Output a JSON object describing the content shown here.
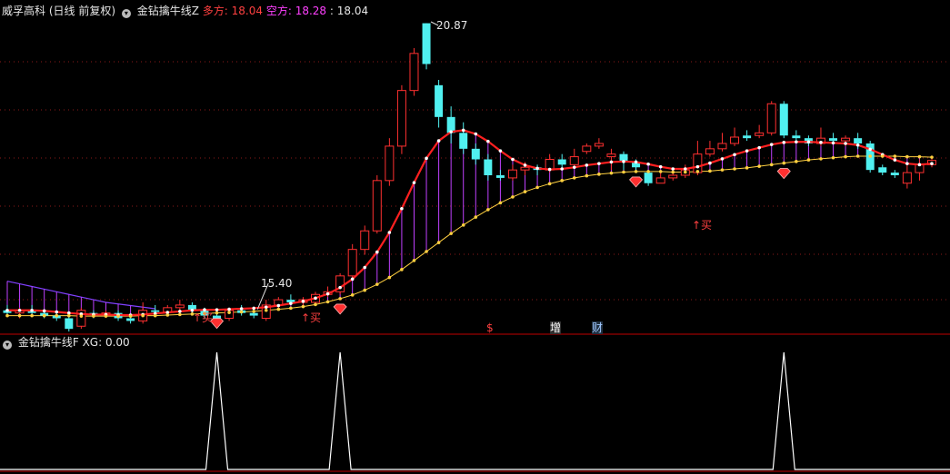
{
  "main_header": {
    "stock": "威孚高科",
    "period": "(日线 前复权)",
    "indicator": "金钻擒牛线Z",
    "bull_label": "多方:",
    "bull_value": "18.04",
    "bear_label": "空方:",
    "bear_value": "18.28",
    "close_value": ": 18.04"
  },
  "sub_header": {
    "indicator": "金钻擒牛线F",
    "xg_label": "XG:",
    "xg_value": "0.00"
  },
  "colors": {
    "up": "#ff3030",
    "down": "#50f0f0",
    "bull_line": "#ff2020",
    "bear_line": "#8040ff",
    "fill": "#c040ff",
    "signal": "#ff3030",
    "grid": "#8b1a1a",
    "xg_line": "#ffffff"
  },
  "annotations": {
    "high": "20.87",
    "low": "15.40",
    "buy": "↑买",
    "mark_dollar": "$",
    "mark_zeng": "增",
    "mark_cai": "财"
  },
  "chart_data": {
    "type": "candlestick",
    "candles": [
      [
        15.45,
        15.4,
        15.55,
        15.35
      ],
      [
        15.4,
        15.45,
        15.5,
        15.3
      ],
      [
        15.45,
        15.4,
        15.55,
        15.35
      ],
      [
        15.4,
        15.35,
        15.45,
        15.3
      ],
      [
        15.35,
        15.3,
        15.4,
        15.25
      ],
      [
        15.3,
        15.1,
        15.35,
        15.05
      ],
      [
        15.15,
        15.45,
        15.5,
        15.1
      ],
      [
        15.4,
        15.38,
        15.45,
        15.3
      ],
      [
        15.38,
        15.4,
        15.45,
        15.32
      ],
      [
        15.4,
        15.3,
        15.45,
        15.25
      ],
      [
        15.3,
        15.25,
        15.38,
        15.2
      ],
      [
        15.25,
        15.45,
        15.6,
        15.2
      ],
      [
        15.45,
        15.42,
        15.55,
        15.38
      ],
      [
        15.42,
        15.5,
        15.55,
        15.4
      ],
      [
        15.5,
        15.55,
        15.65,
        15.45
      ],
      [
        15.55,
        15.45,
        15.6,
        15.4
      ],
      [
        15.45,
        15.35,
        15.5,
        15.3
      ],
      [
        15.35,
        15.3,
        15.4,
        15.28
      ],
      [
        15.3,
        15.45,
        15.5,
        15.25
      ],
      [
        15.45,
        15.4,
        15.55,
        15.35
      ],
      [
        15.4,
        15.35,
        15.5,
        15.3
      ],
      [
        15.3,
        15.55,
        15.65,
        15.25
      ],
      [
        15.55,
        15.65,
        15.7,
        15.5
      ],
      [
        15.65,
        15.6,
        15.75,
        15.55
      ],
      [
        15.6,
        15.65,
        15.7,
        15.55
      ],
      [
        15.6,
        15.75,
        15.8,
        15.55
      ],
      [
        15.75,
        15.8,
        15.9,
        15.7
      ],
      [
        15.8,
        16.1,
        16.15,
        15.75
      ],
      [
        16.1,
        16.6,
        16.7,
        16.05
      ],
      [
        16.6,
        16.95,
        17.05,
        16.5
      ],
      [
        16.95,
        17.9,
        18.0,
        16.9
      ],
      [
        17.9,
        18.55,
        18.7,
        17.8
      ],
      [
        18.55,
        19.6,
        19.7,
        18.4
      ],
      [
        19.6,
        20.3,
        20.4,
        19.5
      ],
      [
        20.87,
        20.1,
        20.87,
        20.0
      ],
      [
        19.7,
        19.1,
        19.8,
        18.9
      ],
      [
        19.1,
        18.8,
        19.3,
        18.6
      ],
      [
        18.8,
        18.5,
        19.0,
        18.4
      ],
      [
        18.5,
        18.3,
        18.6,
        18.2
      ],
      [
        18.3,
        18.0,
        18.4,
        17.9
      ],
      [
        18.0,
        17.95,
        18.1,
        17.9
      ],
      [
        17.95,
        18.1,
        18.2,
        17.9
      ],
      [
        18.1,
        18.15,
        18.25,
        18.0
      ],
      [
        18.15,
        18.1,
        18.2,
        18.0
      ],
      [
        18.1,
        18.3,
        18.4,
        18.05
      ],
      [
        18.3,
        18.2,
        18.4,
        18.1
      ],
      [
        18.2,
        18.35,
        18.5,
        18.15
      ],
      [
        18.45,
        18.55,
        18.6,
        18.4
      ],
      [
        18.55,
        18.6,
        18.7,
        18.5
      ],
      [
        18.35,
        18.4,
        18.5,
        18.1
      ],
      [
        18.4,
        18.25,
        18.45,
        18.1
      ],
      [
        18.25,
        18.15,
        18.3,
        18.05
      ],
      [
        18.05,
        17.85,
        18.1,
        17.8
      ],
      [
        17.85,
        17.95,
        18.05,
        17.85
      ],
      [
        17.95,
        18.0,
        18.1,
        17.9
      ],
      [
        18.0,
        18.1,
        18.2,
        17.95
      ],
      [
        18.05,
        18.4,
        18.65,
        18.0
      ],
      [
        18.4,
        18.5,
        18.65,
        18.35
      ],
      [
        18.5,
        18.6,
        18.8,
        18.45
      ],
      [
        18.6,
        18.72,
        18.9,
        18.55
      ],
      [
        18.75,
        18.7,
        18.85,
        18.65
      ],
      [
        18.75,
        18.8,
        18.95,
        18.7
      ],
      [
        18.8,
        19.35,
        19.4,
        18.75
      ],
      [
        19.35,
        18.75,
        19.4,
        18.7
      ],
      [
        18.75,
        18.7,
        18.85,
        18.6
      ],
      [
        18.7,
        18.6,
        18.75,
        18.55
      ],
      [
        18.6,
        18.7,
        18.9,
        18.55
      ],
      [
        18.7,
        18.65,
        18.8,
        18.6
      ],
      [
        18.65,
        18.7,
        18.75,
        18.55
      ],
      [
        18.7,
        18.6,
        18.8,
        18.5
      ],
      [
        18.6,
        18.1,
        18.65,
        18.05
      ],
      [
        18.15,
        18.05,
        18.2,
        18.0
      ],
      [
        18.05,
        18.0,
        18.1,
        17.95
      ],
      [
        17.85,
        18.05,
        18.2,
        17.75
      ],
      [
        18.05,
        18.2,
        18.3,
        17.9
      ],
      [
        18.2,
        18.28,
        18.35,
        18.15
      ]
    ],
    "bull": [
      15.45,
      15.45,
      15.45,
      15.44,
      15.42,
      15.4,
      15.38,
      15.37,
      15.37,
      15.36,
      15.36,
      15.37,
      15.39,
      15.41,
      15.43,
      15.45,
      15.46,
      15.46,
      15.47,
      15.48,
      15.49,
      15.51,
      15.54,
      15.58,
      15.62,
      15.68,
      15.76,
      15.88,
      16.04,
      16.26,
      16.55,
      16.92,
      17.37,
      17.86,
      18.32,
      18.65,
      18.82,
      18.85,
      18.78,
      18.64,
      18.46,
      18.3,
      18.19,
      18.13,
      18.11,
      18.12,
      18.15,
      18.19,
      18.22,
      18.25,
      18.26,
      18.25,
      18.21,
      18.16,
      18.12,
      18.12,
      18.16,
      18.23,
      18.31,
      18.39,
      18.46,
      18.52,
      18.58,
      18.62,
      18.63,
      18.63,
      18.62,
      18.61,
      18.6,
      18.57,
      18.49,
      18.39,
      18.29,
      18.22,
      18.2,
      18.22
    ],
    "bear": [
      15.35,
      15.35,
      15.35,
      15.35,
      15.35,
      15.35,
      15.34,
      15.34,
      15.34,
      15.34,
      15.34,
      15.35,
      15.35,
      15.36,
      15.37,
      15.38,
      15.39,
      15.4,
      15.41,
      15.42,
      15.43,
      15.45,
      15.47,
      15.49,
      15.52,
      15.56,
      15.61,
      15.67,
      15.74,
      15.83,
      15.94,
      16.07,
      16.22,
      16.39,
      16.56,
      16.73,
      16.9,
      17.06,
      17.21,
      17.35,
      17.48,
      17.59,
      17.69,
      17.77,
      17.84,
      17.9,
      17.95,
      17.99,
      18.02,
      18.04,
      18.06,
      18.07,
      18.07,
      18.07,
      18.06,
      18.06,
      18.07,
      18.08,
      18.1,
      18.12,
      18.14,
      18.17,
      18.2,
      18.23,
      18.26,
      18.29,
      18.31,
      18.33,
      18.35,
      18.36,
      18.36,
      18.36,
      18.36,
      18.35,
      18.35,
      18.34
    ],
    "upper_bear_early": [
      16.0,
      15.95,
      15.9,
      15.85,
      15.8,
      15.75,
      15.7,
      15.65,
      15.6,
      15.57,
      15.54,
      15.51,
      15.48
    ],
    "signal_diamond_idx": [
      17,
      27,
      51,
      63
    ],
    "buy_idx": [
      17,
      27,
      63
    ],
    "xg_idx": [
      17,
      27,
      63
    ],
    "high_idx": 34,
    "low_idx": 20,
    "price_range": [
      15.0,
      21.0
    ]
  }
}
